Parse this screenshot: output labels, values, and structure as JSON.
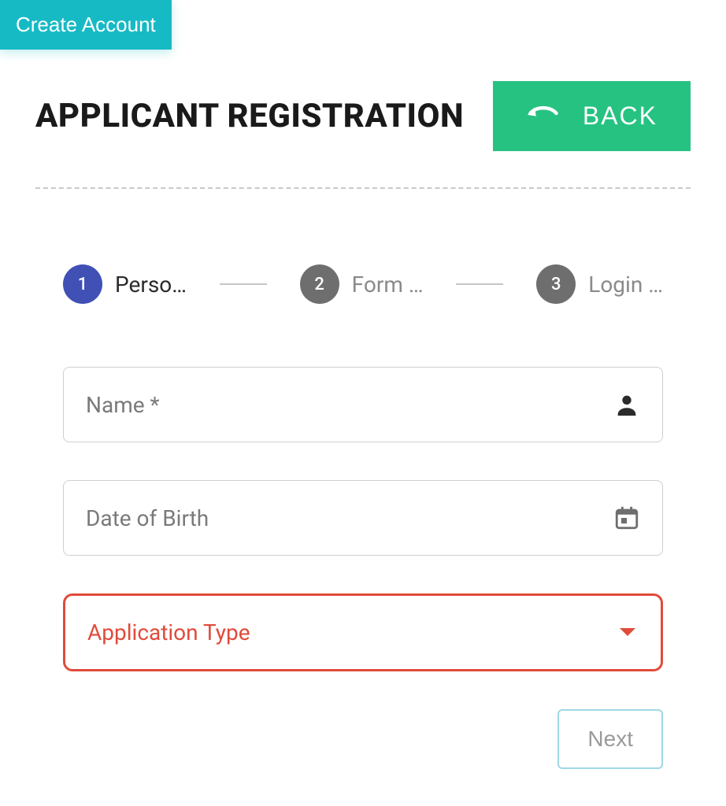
{
  "top_button_label": "Create Account",
  "header": {
    "title": "APPLICANT REGISTRATION",
    "back_label": "BACK"
  },
  "stepper": {
    "steps": [
      {
        "num": "1",
        "label": "Perso…"
      },
      {
        "num": "2",
        "label": "Form …"
      },
      {
        "num": "3",
        "label": "Login …"
      }
    ]
  },
  "fields": {
    "name_label": "Name *",
    "dob_label": "Date of Birth",
    "apptype_label": "Application Type"
  },
  "actions": {
    "next_label": "Next"
  }
}
